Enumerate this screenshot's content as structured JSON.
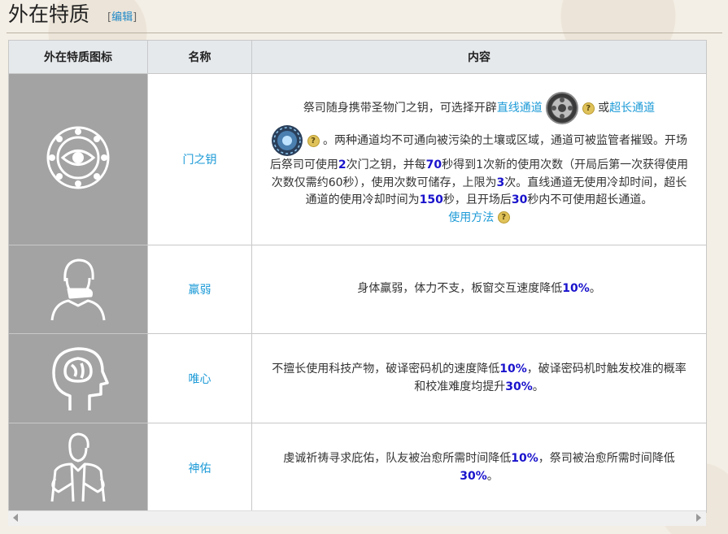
{
  "page_title": "外在特质",
  "edit_open": "[",
  "edit_label": "编辑",
  "edit_close": "]",
  "table": {
    "headers": [
      "外在特质图标",
      "名称",
      "内容"
    ]
  },
  "rows": [
    {
      "name": "门之钥",
      "content": {
        "p1": "祭司随身携带圣物门之钥，可选择开辟",
        "link1": "直线通道",
        "p2": "或",
        "link2": "超长通道",
        "p3": "。两种通道均不可通向被污染的土壤或区域，通道可被监管者摧毁。开场后祭司可使用",
        "h1": "2",
        "p4": "次门之钥，并每",
        "h2": "70",
        "p5": "秒得到1次新的使用次数（开局后第一次获得使用次数仅需约60秒），使用次数可储存，上限为",
        "h3": "3",
        "p6": "次。直线通道无使用冷却时间，超长通道的使用冷却时间为",
        "h4": "150",
        "p7": "秒，且开场后",
        "h5": "30",
        "p8": "秒内不可使用超长通道。",
        "link3": "使用方法"
      }
    },
    {
      "name": "羸弱",
      "content": {
        "p1": "身体羸弱，体力不支，板窗交互速度降低",
        "h1": "10%",
        "p2": "。"
      }
    },
    {
      "name": "唯心",
      "content": {
        "p1": "不擅长使用科技产物，破译密码机的速度降低",
        "h1": "10%",
        "p2": "，破译密码机时触发校准的概率和校准难度均提升",
        "h2": "30%",
        "p3": "。"
      }
    },
    {
      "name": "神佑",
      "content": {
        "p1": "虔诚祈祷寻求庇佑，队友被治愈所需时间降低",
        "h1": "10%",
        "p2": "，祭司被治愈所需时间降低",
        "h2": "30%",
        "p3": "。"
      }
    }
  ],
  "icons": {
    "row0": "door-key-eye-emblem-icon",
    "row1": "frail-coughing-man-icon",
    "row2": "brain-head-profile-icon",
    "row3": "praying-figure-icon",
    "help": "question-mark-icon",
    "help_glyph": "?"
  },
  "colors": {
    "highlight": "#1a13cc",
    "link": "#1e9bd7",
    "icon_bg": "#a3a3a3",
    "header_bg": "#e6e9ec"
  }
}
